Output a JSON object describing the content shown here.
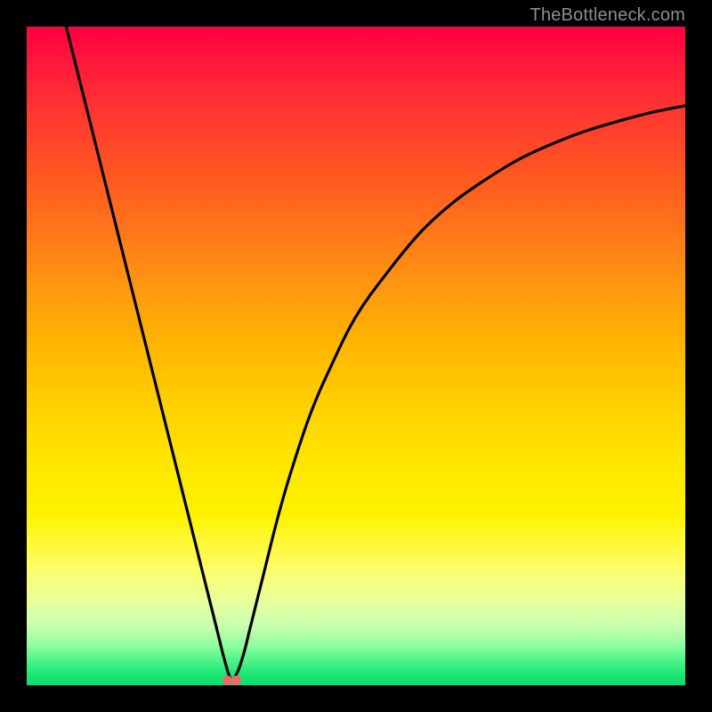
{
  "watermark": "TheBottleneck.com",
  "colors": {
    "background": "#000000",
    "curve": "#000000",
    "marker": "#ef6a62"
  },
  "chart_data": {
    "type": "line",
    "title": "",
    "xlabel": "",
    "ylabel": "",
    "xlim": [
      0,
      100
    ],
    "ylim": [
      0,
      100
    ],
    "grid": false,
    "legend": false,
    "series": [
      {
        "name": "bottleneck-curve",
        "x": [
          6,
          8,
          10,
          12,
          14,
          16,
          18,
          20,
          22,
          24,
          26,
          28,
          29,
          30,
          31,
          32,
          33,
          34,
          36,
          38,
          40,
          43,
          46,
          50,
          55,
          60,
          65,
          70,
          75,
          80,
          85,
          90,
          95,
          100
        ],
        "y": [
          100,
          92,
          84,
          76,
          68,
          60,
          52,
          44,
          36,
          28,
          20,
          12,
          8,
          4,
          1,
          2,
          5,
          9,
          17,
          25,
          32,
          41,
          48,
          56,
          63,
          69,
          73.5,
          77,
          80,
          82.3,
          84.2,
          85.7,
          87,
          88
        ]
      }
    ],
    "markers": [
      {
        "name": "optimal-point-a",
        "x": 30.5,
        "y": 0.8
      },
      {
        "name": "optimal-point-b",
        "x": 31.8,
        "y": 0.8
      }
    ]
  }
}
